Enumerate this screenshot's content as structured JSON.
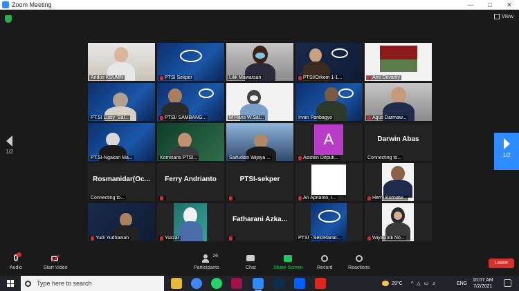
{
  "window": {
    "title": "Zoom Meeting"
  },
  "view": {
    "label": "View"
  },
  "pager": {
    "left": "1/2",
    "right": "1/2"
  },
  "participants_grid": [
    {
      "name": "Andus KSUMN"
    },
    {
      "name": "PTSI Sekper"
    },
    {
      "name": "Lilik Mawarsari"
    },
    {
      "name": "PTSI/Orkom 1-1..."
    },
    {
      "name": "Arni Devanty"
    },
    {
      "name": "PT.SI Luisy_Sal..."
    },
    {
      "name": "PTSI/ SAMBANG..."
    },
    {
      "name": "M Hans W.Sal..."
    },
    {
      "name": "Irvan Panbagyo"
    },
    {
      "name": "Agus Darmaw..."
    },
    {
      "name": "PT.SI-Ngakan Ma..."
    },
    {
      "name": "Komisaris PTSI..."
    },
    {
      "name": "Saifuddin Wijaya ..."
    },
    {
      "name": "Asisten Deputi...",
      "avatar": "A"
    },
    {
      "name": "Connecting to...",
      "bigname": "Darwin Abas"
    },
    {
      "name": "Connecting to...",
      "bigname": "Rosmanidar(Oc..."
    },
    {
      "name": "",
      "bigname": "Ferry Andrianto"
    },
    {
      "name": "",
      "bigname": "PTSI-sekper"
    },
    {
      "name": "Ari Aprianto, I..."
    },
    {
      "name": "Herry Kurniaw..."
    },
    {
      "name": "Yudi Yudhawan"
    },
    {
      "name": "Yulizar"
    },
    {
      "name": "",
      "bigname": "Fatharani Azka..."
    },
    {
      "name": "PTSI - Sekretariat..."
    },
    {
      "name": "Wiyasindi No..."
    }
  ],
  "toolbar": {
    "audio": "Audio",
    "start_video": "Start Video",
    "participants": "Participants",
    "participants_count": "26",
    "chat": "Chat",
    "share_screen": "Share Screen",
    "record": "Record",
    "reactions": "Reactions",
    "leave": "Leave"
  },
  "taskbar": {
    "search_placeholder": "Type here to search",
    "weather": "29°C",
    "lang": "ENG",
    "time": "10:07 AM",
    "date": "7/2/2021"
  },
  "colors": {
    "zoom_blue": "#2d8cff",
    "leave_red": "#d2322d",
    "share_green": "#23c55e",
    "active_yellow": "#f5e400"
  }
}
